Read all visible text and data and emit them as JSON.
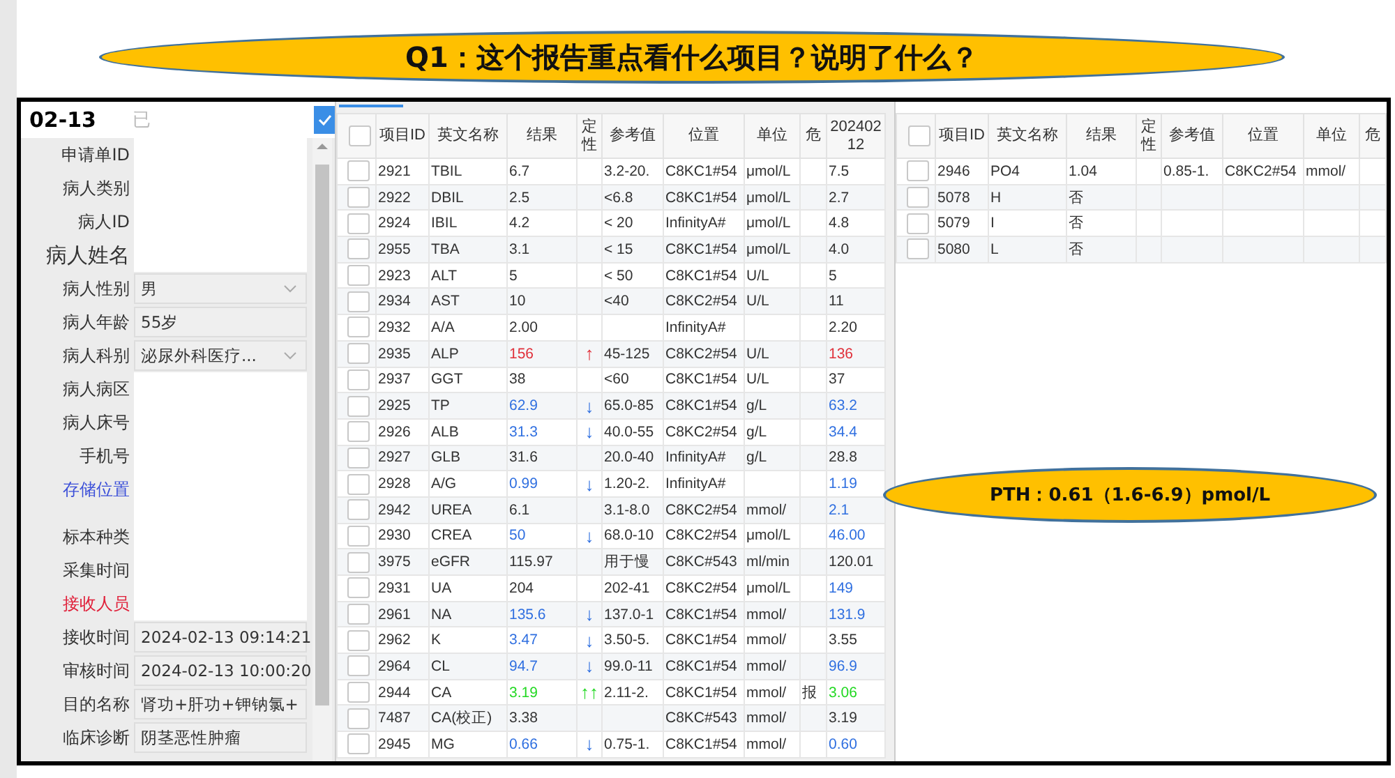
{
  "title": "Q1：这个报告重点看什么项目？说明了什么？",
  "left_panel": {
    "date": "02-13",
    "status": "已",
    "confirmed": true,
    "fields": [
      {
        "label": "申请单ID",
        "kind": "blank",
        "color": "#333333",
        "large": false,
        "spaced": false
      },
      {
        "label": "病人类别",
        "kind": "blank",
        "color": "#333333",
        "large": false,
        "spaced": false
      },
      {
        "label": "病人ID",
        "kind": "blank",
        "color": "#333333",
        "large": false,
        "spaced": false
      },
      {
        "label": "病人姓名",
        "kind": "blank",
        "color": "#333333",
        "large": true,
        "spaced": false
      },
      {
        "label": "病人性别",
        "kind": "select",
        "value": "男",
        "color": "#333333",
        "large": false,
        "spaced": false
      },
      {
        "label": "病人年龄",
        "kind": "text",
        "value": "55岁",
        "color": "#333333",
        "large": false,
        "spaced": false
      },
      {
        "label": "病人科别",
        "kind": "select",
        "value": "泌尿外科医疗...",
        "color": "#333333",
        "large": false,
        "spaced": false
      },
      {
        "label": "病人病区",
        "kind": "blank",
        "color": "#333333",
        "large": false,
        "spaced": false
      },
      {
        "label": "病人床号",
        "kind": "blank",
        "color": "#333333",
        "large": false,
        "spaced": false
      },
      {
        "label": "手机号",
        "kind": "blank",
        "color": "#333333",
        "large": false,
        "spaced": false
      },
      {
        "label": "存储位置",
        "kind": "blank",
        "color": "#3b4fd8",
        "large": false,
        "spaced": false
      },
      {
        "label": "标本种类",
        "kind": "blank",
        "color": "#333333",
        "large": false,
        "spaced": true
      },
      {
        "label": "采集时间",
        "kind": "blank",
        "color": "#333333",
        "large": false,
        "spaced": false
      },
      {
        "label": "接收人员",
        "kind": "blank",
        "color": "#e0203a",
        "large": false,
        "spaced": false
      },
      {
        "label": "接收时间",
        "kind": "text",
        "value": "2024-02-13 09:14:21",
        "color": "#333333",
        "large": false,
        "spaced": false
      },
      {
        "label": "审核时间",
        "kind": "text",
        "value": "2024-02-13 10:00:20",
        "color": "#333333",
        "large": false,
        "spaced": false
      },
      {
        "label": "目的名称",
        "kind": "text",
        "value": "肾功+肝功+钾钠氯+",
        "color": "#333333",
        "large": false,
        "spaced": false
      },
      {
        "label": "临床诊断",
        "kind": "text",
        "value": "阴茎恶性肿瘤",
        "color": "#333333",
        "large": false,
        "spaced": false
      }
    ]
  },
  "main_table": {
    "columns": [
      "项目ID",
      "英文名称",
      "结果",
      "定性",
      "参考值",
      "位置",
      "单位",
      "危",
      "20240212"
    ],
    "header_checked": false,
    "rows": [
      {
        "checked": false,
        "id": "2921",
        "name": "TBIL",
        "result": {
          "text": "6.7",
          "color": "#333333"
        },
        "ref": "3.2-20.",
        "pos": "C8KC1#54",
        "unit": "μmol/L",
        "prior": {
          "text": "7.5",
          "color": "#333333"
        }
      },
      {
        "checked": false,
        "id": "2922",
        "name": "DBIL",
        "result": {
          "text": "2.5",
          "color": "#333333"
        },
        "ref": "<6.8",
        "pos": "C8KC1#54",
        "unit": "μmol/L",
        "prior": {
          "text": "2.7",
          "color": "#333333"
        }
      },
      {
        "checked": false,
        "id": "2924",
        "name": "IBIL",
        "result": {
          "text": "4.2",
          "color": "#333333"
        },
        "ref": "< 20",
        "pos": "InfinityA#",
        "unit": "μmol/L",
        "prior": {
          "text": "4.8",
          "color": "#333333"
        }
      },
      {
        "checked": false,
        "id": "2955",
        "name": "TBA",
        "result": {
          "text": "3.1",
          "color": "#333333"
        },
        "ref": "< 15",
        "pos": "C8KC1#54",
        "unit": "μmol/L",
        "prior": {
          "text": "4.0",
          "color": "#333333"
        }
      },
      {
        "checked": false,
        "id": "2923",
        "name": "ALT",
        "result": {
          "text": "5",
          "color": "#333333"
        },
        "ref": "< 50",
        "pos": "C8KC1#54",
        "unit": "U/L",
        "prior": {
          "text": "5",
          "color": "#333333"
        }
      },
      {
        "checked": false,
        "id": "2934",
        "name": "AST",
        "result": {
          "text": "10",
          "color": "#333333"
        },
        "ref": "<40",
        "pos": "C8KC2#54",
        "unit": "U/L",
        "prior": {
          "text": "11",
          "color": "#333333"
        }
      },
      {
        "checked": false,
        "id": "2932",
        "name": "A/A",
        "result": {
          "text": "2.00",
          "color": "#333333"
        },
        "pos": "InfinityA#",
        "prior": {
          "text": "2.20",
          "color": "#333333"
        }
      },
      {
        "checked": false,
        "id": "2935",
        "name": "ALP",
        "result": {
          "text": "156",
          "color": "#e0303a"
        },
        "arrow": "↑",
        "ref": "45-125",
        "pos": "C8KC2#54",
        "unit": "U/L",
        "prior": {
          "text": "136",
          "color": "#e0303a"
        }
      },
      {
        "checked": false,
        "id": "2937",
        "name": "GGT",
        "result": {
          "text": "38",
          "color": "#333333"
        },
        "ref": "<60",
        "pos": "C8KC1#54",
        "unit": "U/L",
        "prior": {
          "text": "37",
          "color": "#333333"
        }
      },
      {
        "checked": false,
        "id": "2925",
        "name": "TP",
        "result": {
          "text": "62.9",
          "color": "#2f6fe0"
        },
        "arrow": "↓",
        "ref": "65.0-85",
        "pos": "C8KC1#54",
        "unit": "g/L",
        "prior": {
          "text": "63.2",
          "color": "#2f6fe0"
        }
      },
      {
        "checked": false,
        "id": "2926",
        "name": "ALB",
        "result": {
          "text": "31.3",
          "color": "#2f6fe0"
        },
        "arrow": "↓",
        "ref": "40.0-55",
        "pos": "C8KC2#54",
        "unit": "g/L",
        "prior": {
          "text": "34.4",
          "color": "#2f6fe0"
        }
      },
      {
        "checked": false,
        "id": "2927",
        "name": "GLB",
        "result": {
          "text": "31.6",
          "color": "#333333"
        },
        "ref": "20.0-40",
        "pos": "InfinityA#",
        "unit": "g/L",
        "prior": {
          "text": "28.8",
          "color": "#333333"
        }
      },
      {
        "checked": false,
        "id": "2928",
        "name": "A/G",
        "result": {
          "text": "0.99",
          "color": "#2f6fe0"
        },
        "arrow": "↓",
        "ref": "1.20-2.",
        "pos": "InfinityA#",
        "prior": {
          "text": "1.19",
          "color": "#2f6fe0"
        }
      },
      {
        "checked": false,
        "id": "2942",
        "name": "UREA",
        "result": {
          "text": "6.1",
          "color": "#333333"
        },
        "ref": "3.1-8.0",
        "pos": "C8KC2#54",
        "unit": "mmol/",
        "prior": {
          "text": "2.1",
          "color": "#2f6fe0"
        }
      },
      {
        "checked": false,
        "id": "2930",
        "name": "CREA",
        "result": {
          "text": "50",
          "color": "#2f6fe0"
        },
        "arrow": "↓",
        "ref": "68.0-10",
        "pos": "C8KC2#54",
        "unit": "μmol/L",
        "prior": {
          "text": "46.00",
          "color": "#2f6fe0"
        }
      },
      {
        "checked": false,
        "id": "3975",
        "name": "eGFR",
        "result": {
          "text": "115.97",
          "color": "#333333"
        },
        "ref": "用于慢",
        "pos": "C8KC#543",
        "unit": "ml/min",
        "prior": {
          "text": "120.01",
          "color": "#333333"
        }
      },
      {
        "checked": false,
        "id": "2931",
        "name": "UA",
        "result": {
          "text": "204",
          "color": "#333333"
        },
        "ref": "202-41",
        "pos": "C8KC2#54",
        "unit": "μmol/L",
        "prior": {
          "text": "149",
          "color": "#2f6fe0"
        }
      },
      {
        "checked": false,
        "id": "2961",
        "name": "NA",
        "result": {
          "text": "135.6",
          "color": "#2f6fe0"
        },
        "arrow": "↓",
        "ref": "137.0-1",
        "pos": "C8KC1#54",
        "unit": "mmol/",
        "prior": {
          "text": "131.9",
          "color": "#2f6fe0"
        }
      },
      {
        "checked": false,
        "id": "2962",
        "name": "K",
        "result": {
          "text": "3.47",
          "color": "#2f6fe0"
        },
        "arrow": "↓",
        "ref": "3.50-5.",
        "pos": "C8KC1#54",
        "unit": "mmol/",
        "prior": {
          "text": "3.55",
          "color": "#333333"
        }
      },
      {
        "checked": false,
        "id": "2964",
        "name": "CL",
        "result": {
          "text": "94.7",
          "color": "#2f6fe0"
        },
        "arrow": "↓",
        "ref": "99.0-11",
        "pos": "C8KC1#54",
        "unit": "mmol/",
        "prior": {
          "text": "96.9",
          "color": "#2f6fe0"
        }
      },
      {
        "checked": false,
        "id": "2944",
        "name": "CA",
        "result": {
          "text": "3.19",
          "color": "#22d822"
        },
        "arrow": "↑↑",
        "ref": "2.11-2.",
        "pos": "C8KC1#54",
        "unit": "mmol/",
        "crit": "报",
        "prior": {
          "text": "3.06",
          "color": "#22d822"
        }
      },
      {
        "checked": false,
        "id": "7487",
        "name": "CA(校正)",
        "result": {
          "text": "3.38",
          "color": "#333333"
        },
        "pos": "C8KC#543",
        "unit": "mmol/",
        "prior": {
          "text": "3.19",
          "color": "#333333"
        }
      },
      {
        "checked": false,
        "id": "2945",
        "name": "MG",
        "result": {
          "text": "0.66",
          "color": "#2f6fe0"
        },
        "arrow": "↓",
        "ref": "0.75-1.",
        "pos": "C8KC1#54",
        "unit": "mmol/",
        "prior": {
          "text": "0.60",
          "color": "#2f6fe0"
        }
      }
    ]
  },
  "side_table": {
    "columns": [
      "项目ID",
      "英文名称",
      "结果",
      "定性",
      "参考值",
      "位置",
      "单位",
      "危"
    ],
    "header_checked": false,
    "rows": [
      {
        "checked": false,
        "id": "2946",
        "name": "PO4",
        "result": {
          "text": "1.04",
          "color": "#333333"
        },
        "ref": "0.85-1.",
        "pos": "C8KC2#54",
        "unit": "mmol/"
      },
      {
        "checked": false,
        "id": "5078",
        "name": "H",
        "result": {
          "text": "否",
          "color": "#333333"
        }
      },
      {
        "checked": false,
        "id": "5079",
        "name": "I",
        "result": {
          "text": "否",
          "color": "#333333"
        }
      },
      {
        "checked": false,
        "id": "5080",
        "name": "L",
        "result": {
          "text": "否",
          "color": "#333333"
        }
      }
    ]
  },
  "callout": "PTH：0.61（1.6-6.9）pmol/L"
}
